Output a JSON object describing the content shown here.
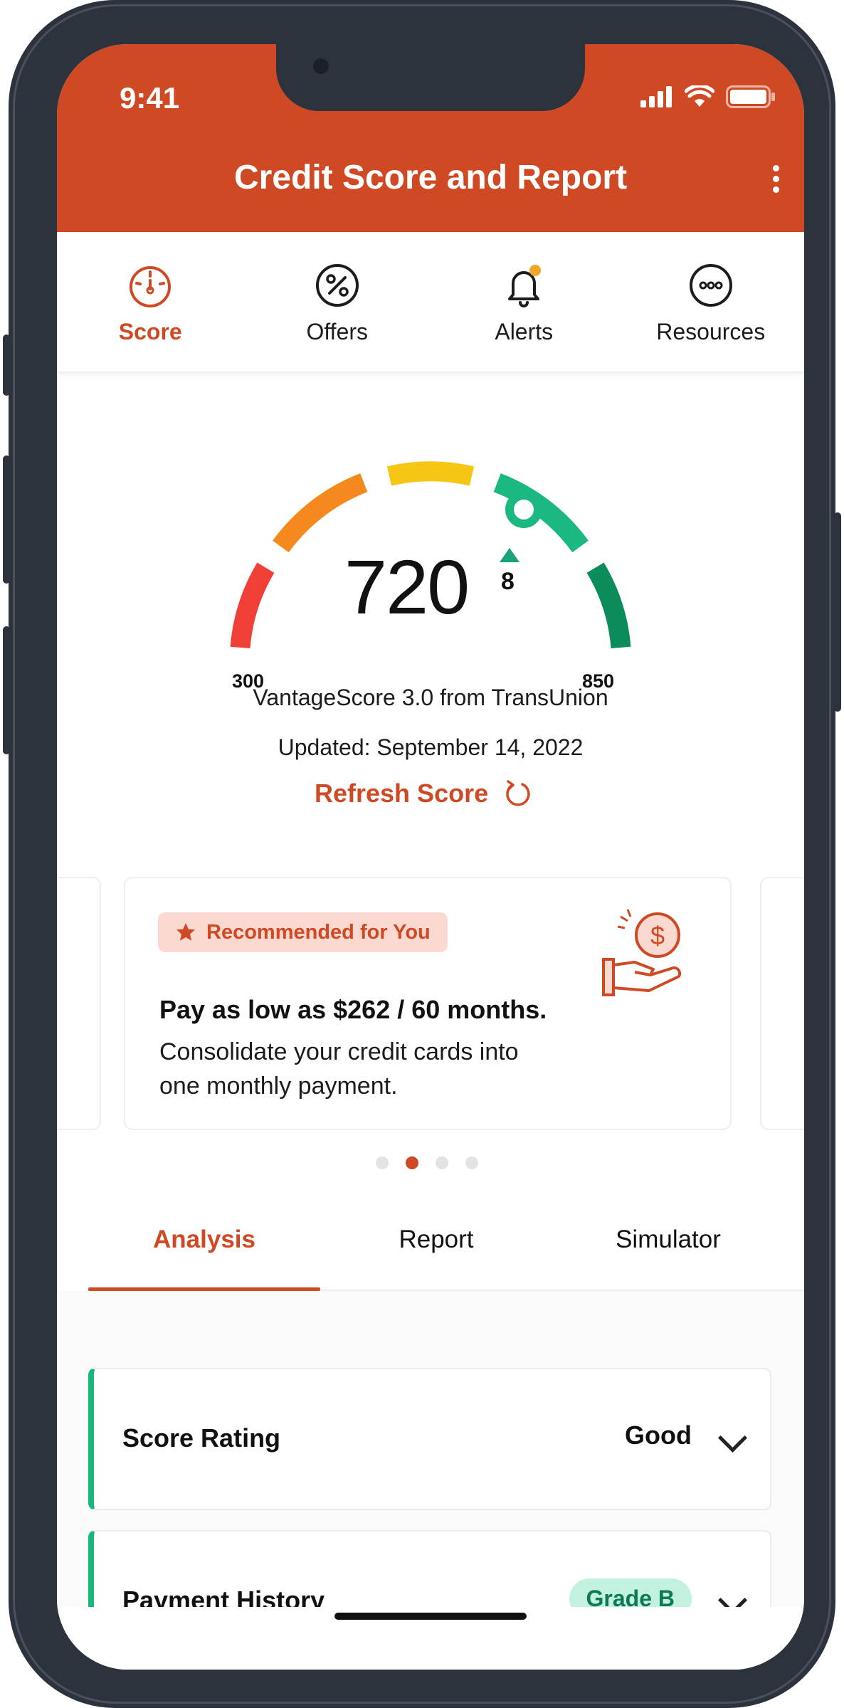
{
  "status_bar": {
    "time": "9:41"
  },
  "header": {
    "title": "Credit Score and Report"
  },
  "top_tabs": [
    {
      "label": "Score",
      "active": true,
      "icon": "gauge-icon"
    },
    {
      "label": "Offers",
      "active": false,
      "icon": "percent-icon"
    },
    {
      "label": "Alerts",
      "active": false,
      "icon": "bell-icon"
    },
    {
      "label": "Resources",
      "active": false,
      "icon": "more-circle-icon"
    }
  ],
  "score": {
    "value": "720",
    "change": "8",
    "min": "300",
    "max": "850",
    "source": "VantageScore 3.0 from TransUnion",
    "updated": "Updated: September 14, 2022",
    "refresh_label": "Refresh Score"
  },
  "offer_card": {
    "badge": "Recommended for You",
    "headline": "Pay as low as $262 / 60 months.",
    "body": "Consolidate your credit cards into one monthly payment.",
    "icon": "hand-dollar-icon"
  },
  "carousel": {
    "total": 4,
    "active_index": 1
  },
  "sub_tabs": [
    {
      "label": "Analysis",
      "active": true
    },
    {
      "label": "Report",
      "active": false
    },
    {
      "label": "Simulator",
      "active": false
    }
  ],
  "analysis": {
    "score_rating": {
      "label": "Score Rating",
      "value": "Good"
    },
    "payment_history": {
      "label": "Payment History",
      "grade": "Grade B"
    }
  },
  "colors": {
    "brand": "#cf4a24",
    "good": "#18b77b"
  }
}
